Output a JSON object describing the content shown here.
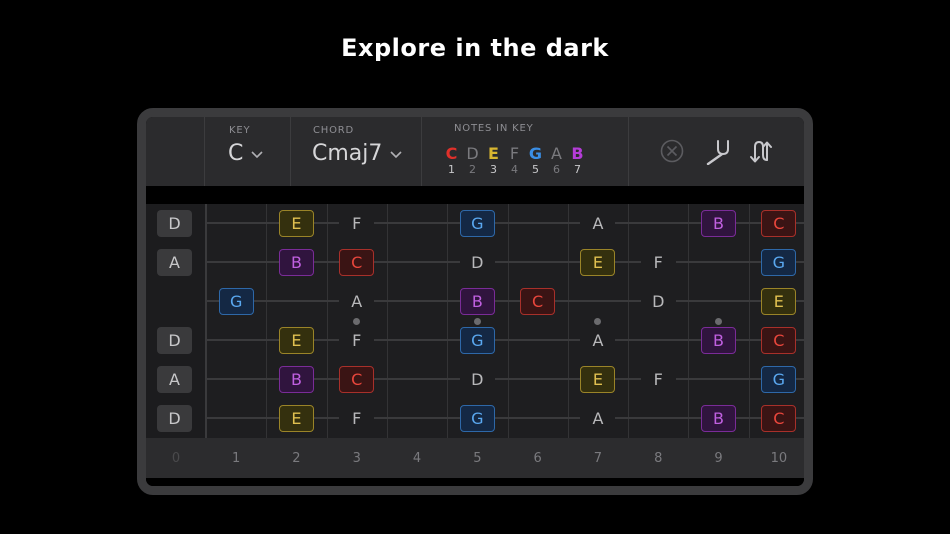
{
  "headline": "Explore in the dark",
  "topbar": {
    "key_label": "KEY",
    "key_value": "C",
    "chord_label": "CHORD",
    "chord_value": "Cmaj7",
    "notes_label": "NOTES IN KEY",
    "notes": [
      {
        "name": "C",
        "degree": "1",
        "in_chord": true,
        "color": "#e0302a"
      },
      {
        "name": "D",
        "degree": "2",
        "in_chord": false,
        "color": "#7a7a7e"
      },
      {
        "name": "E",
        "degree": "3",
        "in_chord": true,
        "color": "#d8b630"
      },
      {
        "name": "F",
        "degree": "4",
        "in_chord": false,
        "color": "#7a7a7e"
      },
      {
        "name": "G",
        "degree": "5",
        "in_chord": true,
        "color": "#3a8ee6"
      },
      {
        "name": "A",
        "degree": "6",
        "in_chord": false,
        "color": "#7a7a7e"
      },
      {
        "name": "B",
        "degree": "7",
        "in_chord": true,
        "color": "#b43cd8"
      }
    ],
    "icons": [
      "clear-icon",
      "tuning-fork-icon",
      "swap-icon"
    ]
  },
  "strings": [
    {
      "open": "D",
      "notes": [
        [
          2,
          "E"
        ],
        [
          3,
          "F"
        ],
        [
          5,
          "G"
        ],
        [
          7,
          "A"
        ],
        [
          9,
          "B"
        ],
        [
          10,
          "C"
        ]
      ]
    },
    {
      "open": "A",
      "notes": [
        [
          2,
          "B"
        ],
        [
          3,
          "C"
        ],
        [
          5,
          "D"
        ],
        [
          7,
          "E"
        ],
        [
          8,
          "F"
        ],
        [
          10,
          "G"
        ]
      ]
    },
    {
      "open": "",
      "notes": [
        [
          1,
          "G"
        ],
        [
          3,
          "A"
        ],
        [
          5,
          "B"
        ],
        [
          6,
          "C"
        ],
        [
          8,
          "D"
        ],
        [
          10,
          "E"
        ]
      ]
    },
    {
      "open": "D",
      "notes": [
        [
          2,
          "E"
        ],
        [
          3,
          "F"
        ],
        [
          5,
          "G"
        ],
        [
          7,
          "A"
        ],
        [
          9,
          "B"
        ],
        [
          10,
          "C"
        ]
      ]
    },
    {
      "open": "A",
      "notes": [
        [
          2,
          "B"
        ],
        [
          3,
          "C"
        ],
        [
          5,
          "D"
        ],
        [
          7,
          "E"
        ],
        [
          8,
          "F"
        ],
        [
          10,
          "G"
        ]
      ]
    },
    {
      "open": "D",
      "notes": [
        [
          2,
          "E"
        ],
        [
          3,
          "F"
        ],
        [
          5,
          "G"
        ],
        [
          7,
          "A"
        ],
        [
          9,
          "B"
        ],
        [
          10,
          "C"
        ]
      ]
    }
  ],
  "fret_numbers": [
    "0",
    "1",
    "2",
    "3",
    "4",
    "5",
    "6",
    "7",
    "8",
    "9",
    "10"
  ],
  "inlay_frets": [
    3,
    5,
    7,
    9
  ],
  "chord_colors": {
    "C": {
      "text": "#e8463c",
      "bg": "#3a1414",
      "border": "#a8302a"
    },
    "E": {
      "text": "#e0c050",
      "bg": "#34300e",
      "border": "#9a8428"
    },
    "G": {
      "text": "#5aa8f0",
      "bg": "#142844",
      "border": "#2e68a8"
    },
    "B": {
      "text": "#c060e0",
      "bg": "#30143e",
      "border": "#7a2c98"
    }
  }
}
